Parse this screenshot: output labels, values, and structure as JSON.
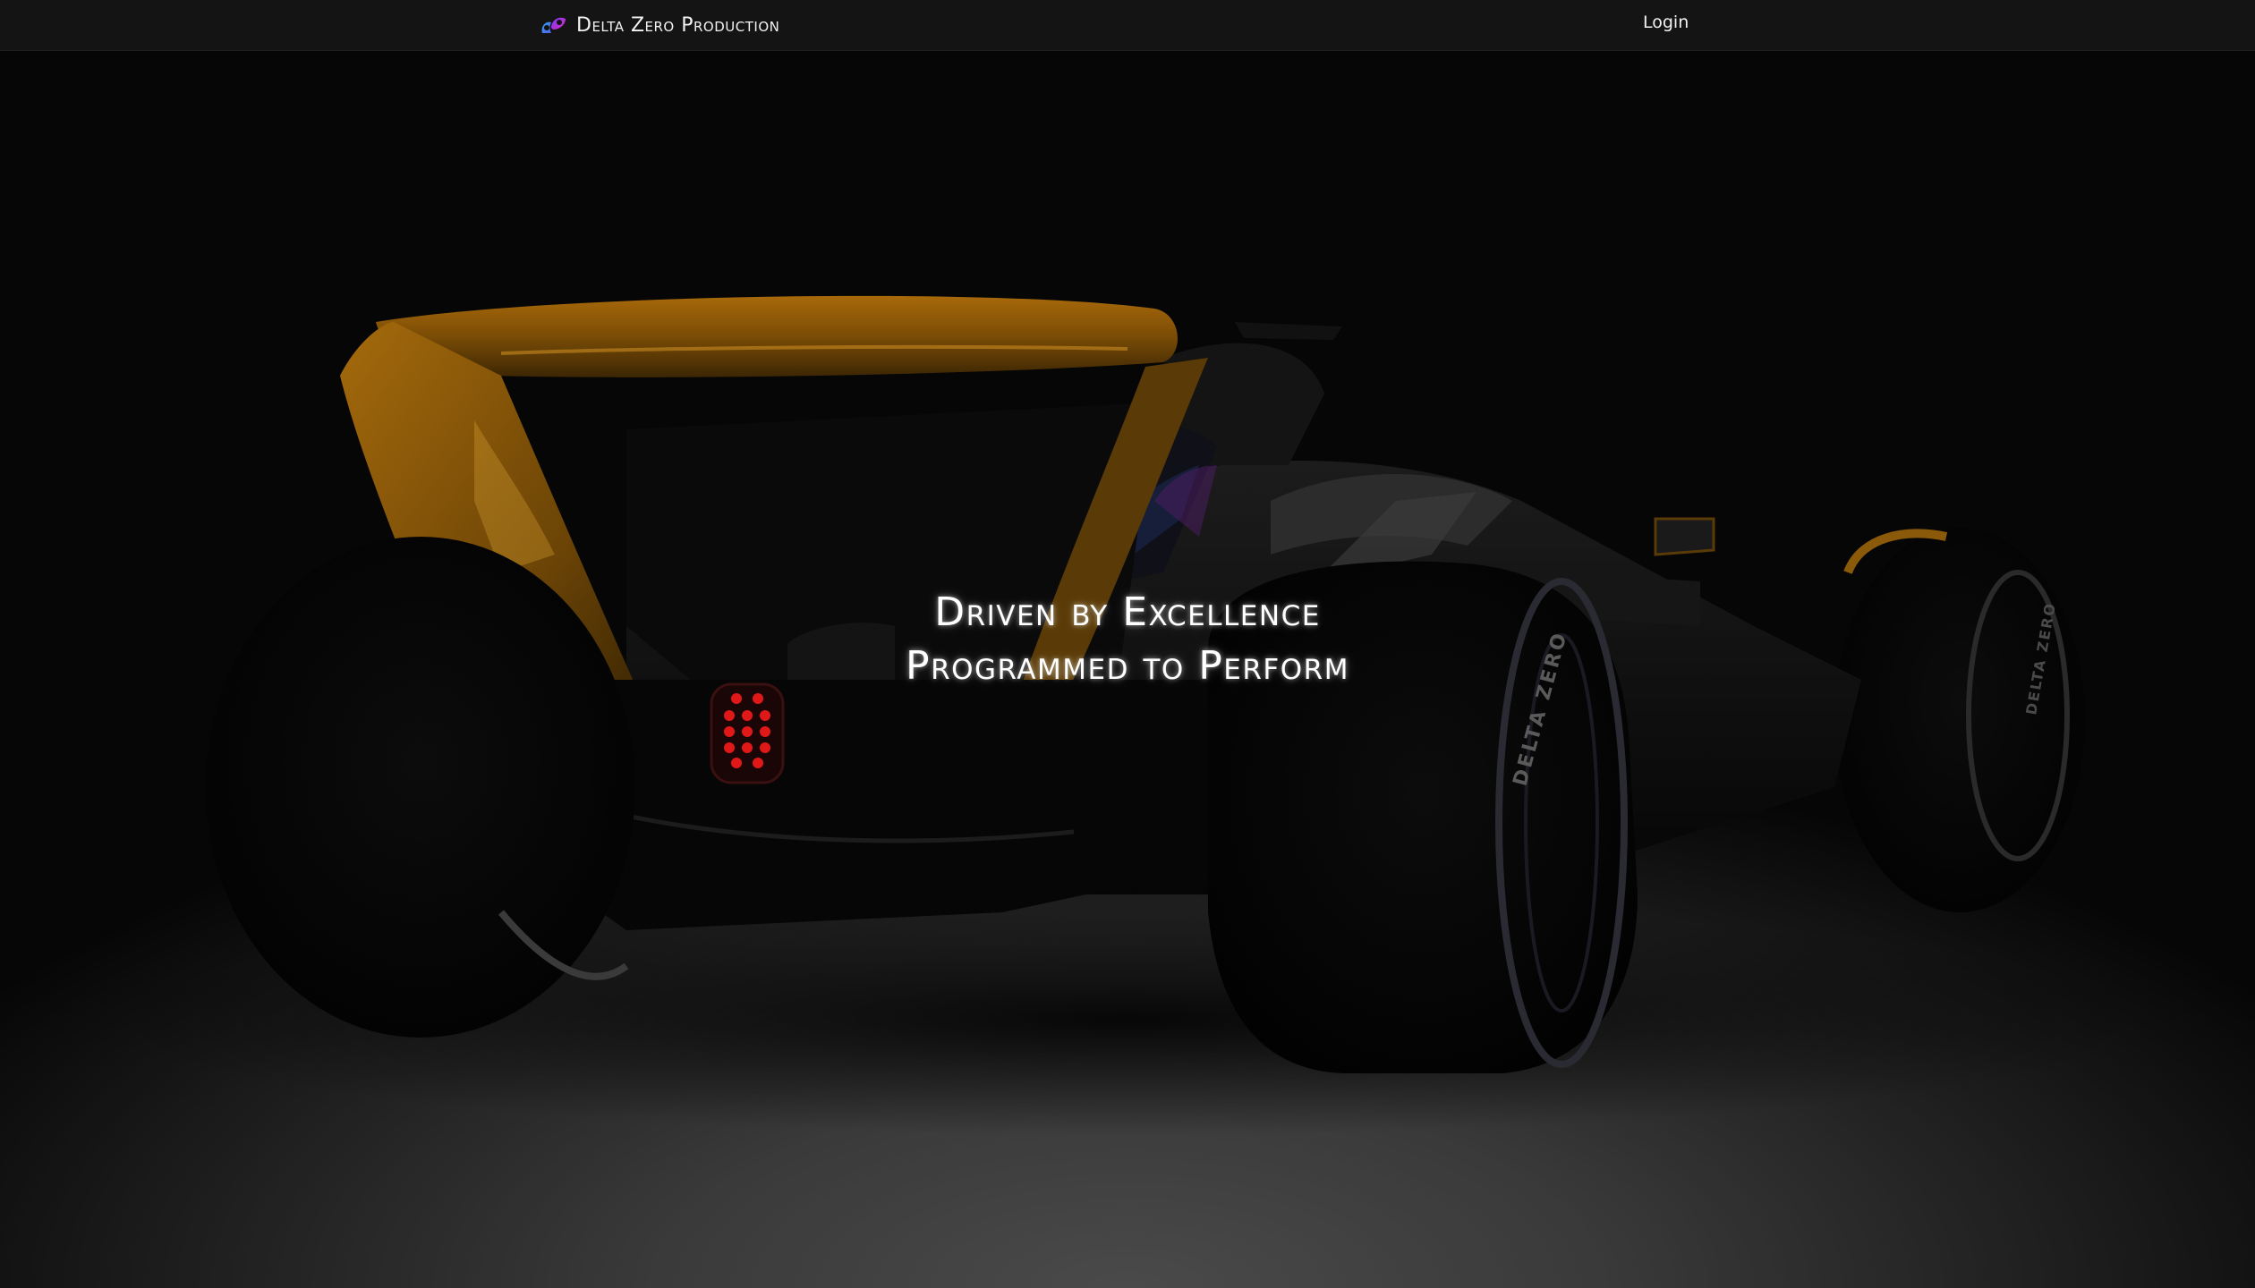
{
  "navbar": {
    "brand_name": "Delta Zero Production",
    "logo_icon": "delta-zero-logo-icon",
    "login_label": "Login"
  },
  "hero": {
    "headline_line1": "Driven by Excellence",
    "headline_line2": "Programmed to Perform",
    "background_image": "dark-race-car-rear-view",
    "tire_text": "DELTA ZERO"
  },
  "colors": {
    "navbar_bg": "#141414",
    "accent_orange": "#c8860a",
    "logo_blue": "#2aa4e8",
    "logo_magenta": "#c82ad8",
    "tail_light_red": "#e01818"
  }
}
